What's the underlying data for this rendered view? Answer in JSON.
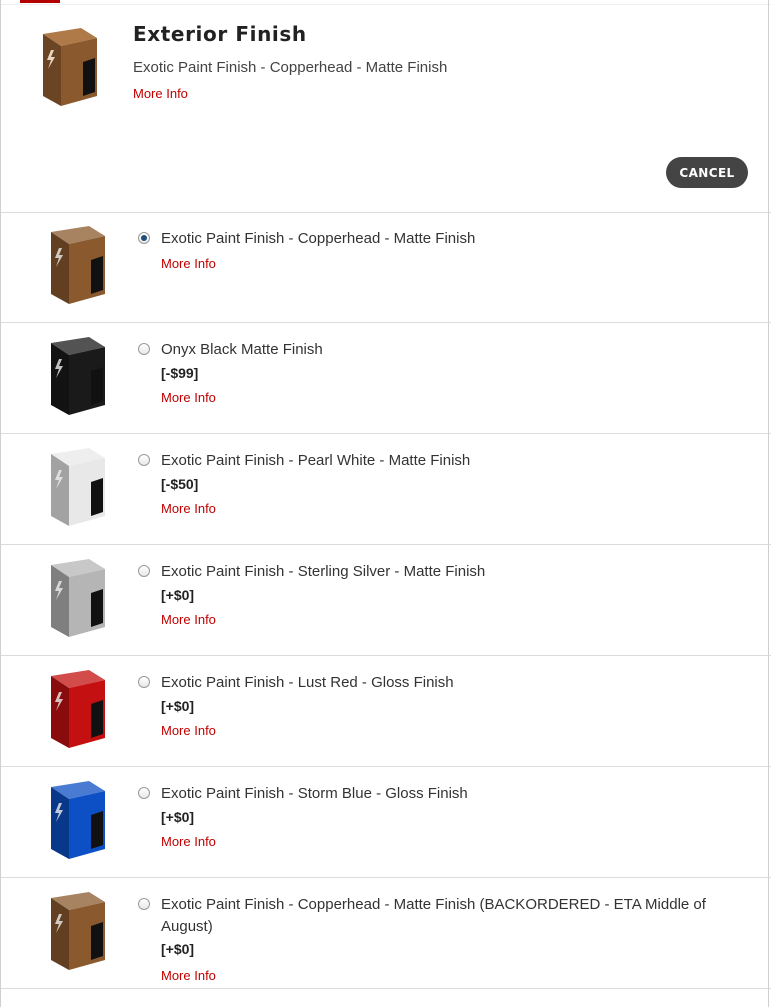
{
  "header": {
    "title": "Exterior Finish",
    "selected": "Exotic Paint Finish - Copperhead - Matte Finish",
    "more_info": "More Info",
    "cancel": "CANCEL"
  },
  "options": [
    {
      "label": "Exotic Paint Finish - Copperhead - Matte Finish",
      "price": "",
      "more_info": "More Info",
      "selected": true,
      "color": "#8a5a2e"
    },
    {
      "label": "Onyx Black Matte Finish",
      "price": "[-$99]",
      "more_info": "More Info",
      "selected": false,
      "color": "#1a1a1a"
    },
    {
      "label": "Exotic Paint Finish - Pearl White - Matte Finish",
      "price": "[-$50]",
      "more_info": "More Info",
      "selected": false,
      "color": "#e8e8e8"
    },
    {
      "label": "Exotic Paint Finish - Sterling Silver - Matte Finish",
      "price": "[+$0]",
      "more_info": "More Info",
      "selected": false,
      "color": "#b5b5b5"
    },
    {
      "label": "Exotic Paint Finish - Lust Red - Gloss Finish",
      "price": "[+$0]",
      "more_info": "More Info",
      "selected": false,
      "color": "#c41010"
    },
    {
      "label": "Exotic Paint Finish - Storm Blue - Gloss Finish",
      "price": "[+$0]",
      "more_info": "More Info",
      "selected": false,
      "color": "#0d4fc4"
    },
    {
      "label": "Exotic Paint Finish - Copperhead - Matte Finish (BACKORDERED - ETA Middle of August)",
      "price": "[+$0]",
      "more_info": "More Info",
      "selected": false,
      "color": "#8a5a2e"
    }
  ],
  "colors": {
    "accent": "#c00000",
    "button": "#444444"
  }
}
